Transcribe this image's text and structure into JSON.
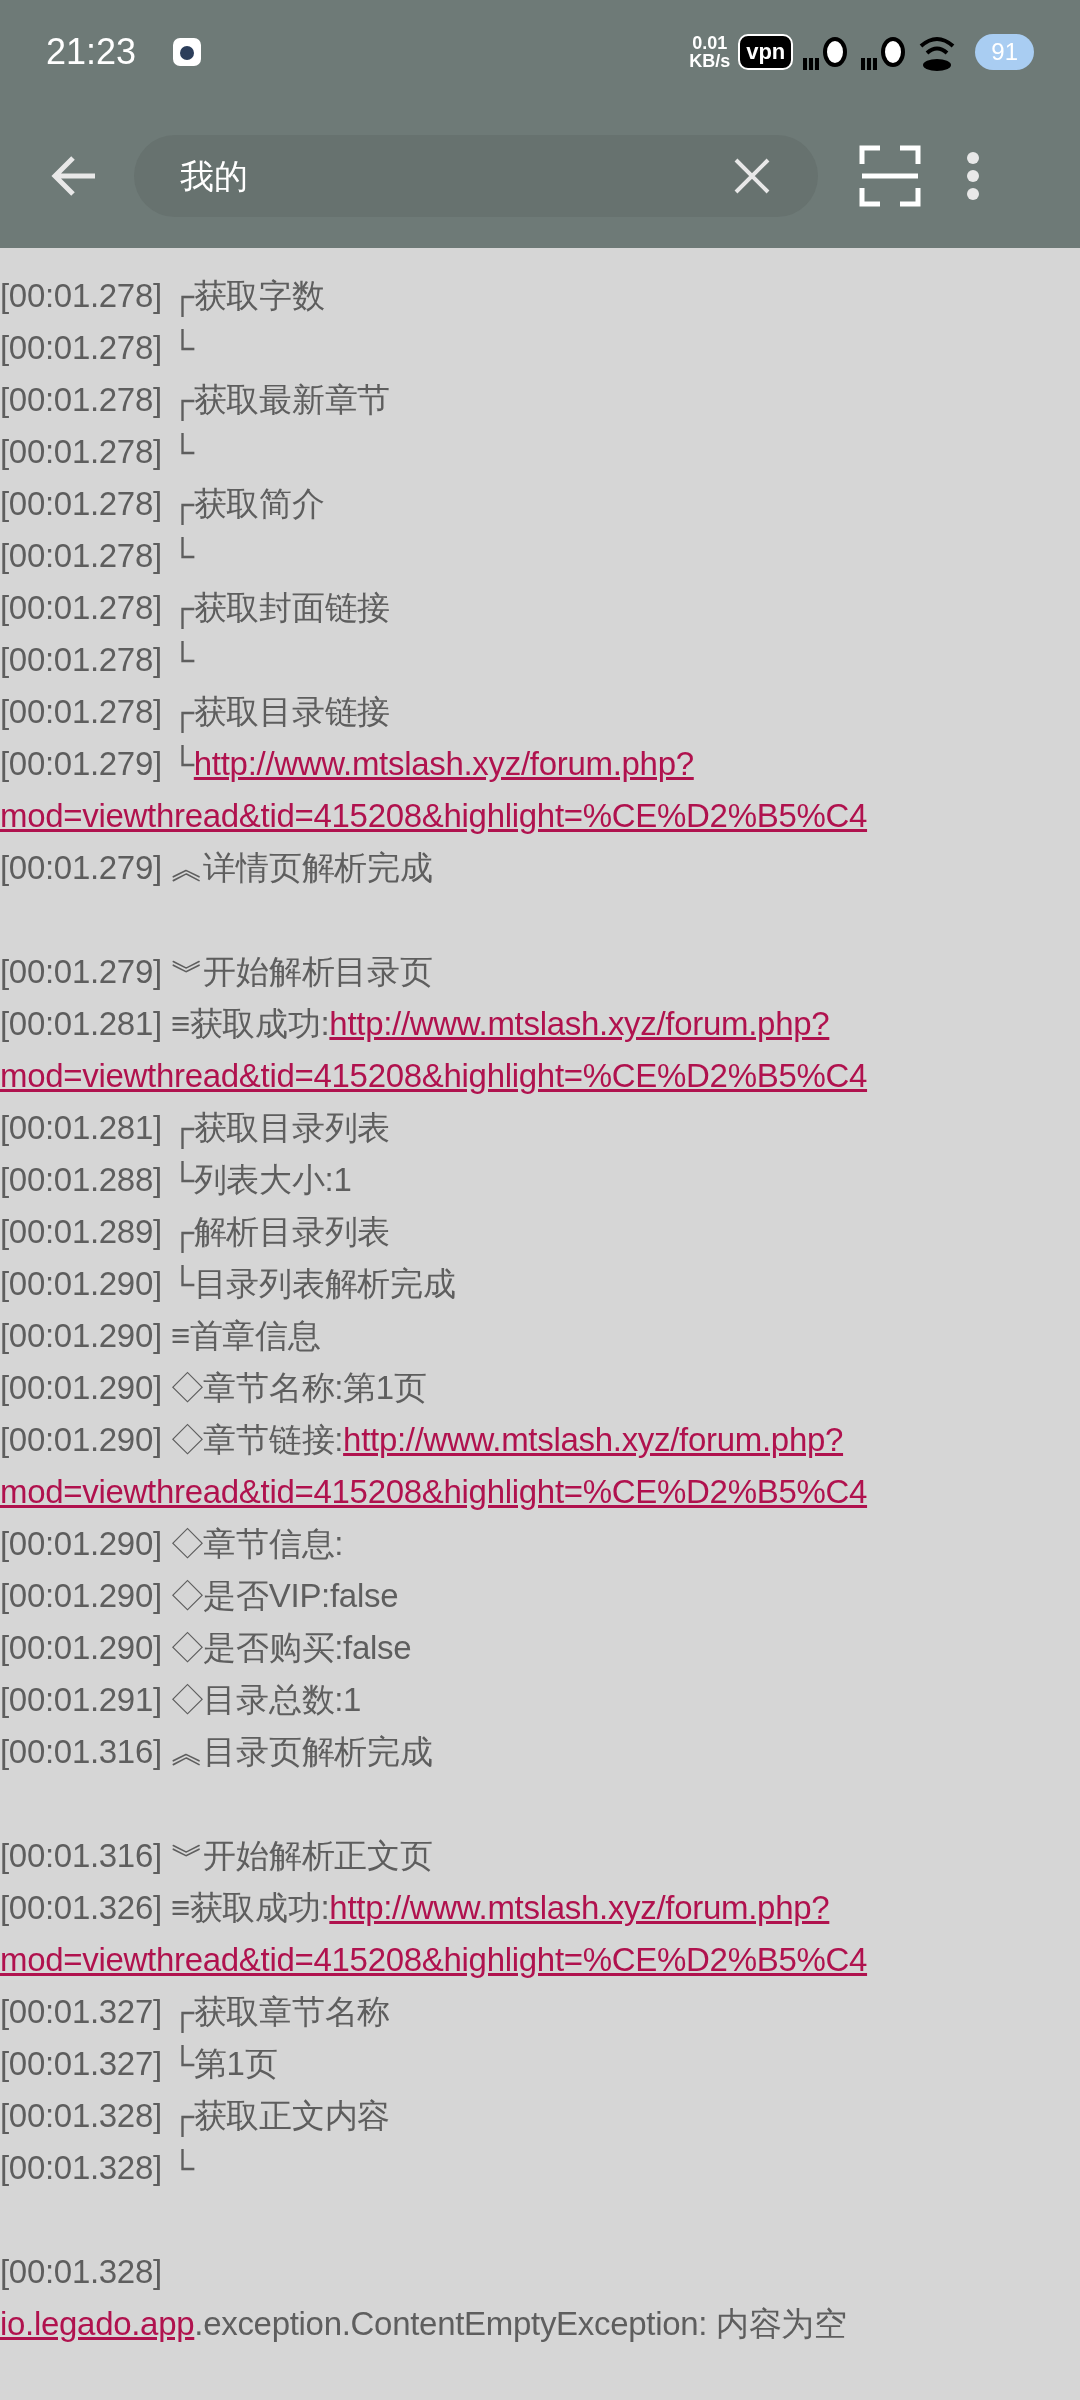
{
  "status_bar": {
    "time": "21:23",
    "net_speed": [
      "0.01",
      "KB/s"
    ],
    "vpn": "vpn",
    "battery": "91"
  },
  "toolbar": {
    "search_value": "我的"
  },
  "log": [
    {
      "segments": [
        {
          "kind": "text",
          "text": "[00:01.278] ┌获取字数"
        }
      ]
    },
    {
      "segments": [
        {
          "kind": "text",
          "text": "[00:01.278] └"
        }
      ]
    },
    {
      "segments": [
        {
          "kind": "text",
          "text": "[00:01.278] ┌获取最新章节"
        }
      ]
    },
    {
      "segments": [
        {
          "kind": "text",
          "text": "[00:01.278] └"
        }
      ]
    },
    {
      "segments": [
        {
          "kind": "text",
          "text": "[00:01.278] ┌获取简介"
        }
      ]
    },
    {
      "segments": [
        {
          "kind": "text",
          "text": "[00:01.278] └"
        }
      ]
    },
    {
      "segments": [
        {
          "kind": "text",
          "text": "[00:01.278] ┌获取封面链接"
        }
      ]
    },
    {
      "segments": [
        {
          "kind": "text",
          "text": "[00:01.278] └"
        }
      ]
    },
    {
      "segments": [
        {
          "kind": "text",
          "text": "[00:01.278] ┌获取目录链接"
        }
      ]
    },
    {
      "segments": [
        {
          "kind": "text",
          "text": "[00:01.279] └"
        },
        {
          "kind": "link",
          "text": "http://www.mtslash.xyz/forum.php?"
        },
        {
          "kind": "break"
        },
        {
          "kind": "link",
          "text": "mod=viewthread&tid=415208&highlight=%CE%D2%B5%C4"
        }
      ]
    },
    {
      "segments": [
        {
          "kind": "text",
          "text": "[00:01.279] ︽详情页解析完成"
        }
      ]
    },
    {
      "gap_before": true,
      "segments": [
        {
          "kind": "text",
          "text": "[00:01.279] ︾开始解析目录页"
        }
      ]
    },
    {
      "segments": [
        {
          "kind": "text",
          "text": "[00:01.281] ≡获取成功:"
        },
        {
          "kind": "link",
          "text": "http://www.mtslash.xyz/forum.php?"
        },
        {
          "kind": "break"
        },
        {
          "kind": "link",
          "text": "mod=viewthread&tid=415208&highlight=%CE%D2%B5%C4"
        }
      ]
    },
    {
      "segments": [
        {
          "kind": "text",
          "text": "[00:01.281] ┌获取目录列表"
        }
      ]
    },
    {
      "segments": [
        {
          "kind": "text",
          "text": "[00:01.288] └列表大小:1"
        }
      ]
    },
    {
      "segments": [
        {
          "kind": "text",
          "text": "[00:01.289] ┌解析目录列表"
        }
      ]
    },
    {
      "segments": [
        {
          "kind": "text",
          "text": "[00:01.290] └目录列表解析完成"
        }
      ]
    },
    {
      "segments": [
        {
          "kind": "text",
          "text": "[00:01.290] ≡首章信息"
        }
      ]
    },
    {
      "segments": [
        {
          "kind": "text",
          "text": "[00:01.290] ◇章节名称:第1页"
        }
      ]
    },
    {
      "segments": [
        {
          "kind": "text",
          "text": "[00:01.290] ◇章节链接:"
        },
        {
          "kind": "link",
          "text": "http://www.mtslash.xyz/forum.php?"
        },
        {
          "kind": "break"
        },
        {
          "kind": "link",
          "text": "mod=viewthread&tid=415208&highlight=%CE%D2%B5%C4"
        }
      ]
    },
    {
      "segments": [
        {
          "kind": "text",
          "text": "[00:01.290] ◇章节信息:"
        }
      ]
    },
    {
      "segments": [
        {
          "kind": "text",
          "text": "[00:01.290] ◇是否VIP:false"
        }
      ]
    },
    {
      "segments": [
        {
          "kind": "text",
          "text": "[00:01.290] ◇是否购买:false"
        }
      ]
    },
    {
      "segments": [
        {
          "kind": "text",
          "text": "[00:01.291] ◇目录总数:1"
        }
      ]
    },
    {
      "segments": [
        {
          "kind": "text",
          "text": "[00:01.316] ︽目录页解析完成"
        }
      ]
    },
    {
      "gap_before": true,
      "segments": [
        {
          "kind": "text",
          "text": "[00:01.316] ︾开始解析正文页"
        }
      ]
    },
    {
      "segments": [
        {
          "kind": "text",
          "text": "[00:01.326] ≡获取成功:"
        },
        {
          "kind": "link",
          "text": "http://www.mtslash.xyz/forum.php?"
        },
        {
          "kind": "break"
        },
        {
          "kind": "link",
          "text": "mod=viewthread&tid=415208&highlight=%CE%D2%B5%C4"
        }
      ]
    },
    {
      "segments": [
        {
          "kind": "text",
          "text": "[00:01.327] ┌获取章节名称"
        }
      ]
    },
    {
      "segments": [
        {
          "kind": "text",
          "text": "[00:01.327] └第1页"
        }
      ]
    },
    {
      "segments": [
        {
          "kind": "text",
          "text": "[00:01.328] ┌获取正文内容"
        }
      ]
    },
    {
      "segments": [
        {
          "kind": "text",
          "text": "[00:01.328] └"
        }
      ]
    },
    {
      "gap_before": true,
      "segments": [
        {
          "kind": "text",
          "text": "[00:01.328]"
        },
        {
          "kind": "break"
        },
        {
          "kind": "link",
          "text": "io.legado.app"
        },
        {
          "kind": "text",
          "text": ".exception.ContentEmptyException: 内容为空"
        }
      ]
    }
  ]
}
